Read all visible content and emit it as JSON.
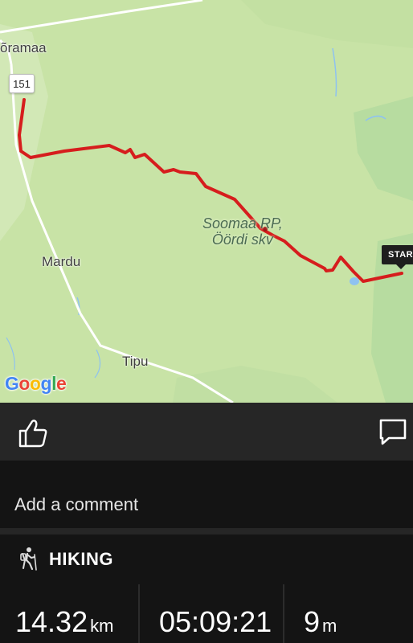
{
  "map": {
    "labels": {
      "oramaa": "õramaa",
      "mardu": "Mardu",
      "tipu": "Tipu",
      "poi_line1": "Soomaa RP,",
      "poi_line2": "Öördi skv"
    },
    "road_number": "151",
    "start_marker": "START",
    "attribution": [
      "G",
      "o",
      "o",
      "g",
      "l",
      "e"
    ],
    "colors": {
      "land": "#c8e3a6",
      "forest": "#b4d99b",
      "road": "#ffffff",
      "route": "#d61d1d",
      "water": "#8ec2f0"
    }
  },
  "actions": {
    "like_icon": "thumbs-up-icon",
    "comment_icon": "comment-icon"
  },
  "comment": {
    "placeholder": "Add a comment"
  },
  "activity": {
    "icon": "hiker-icon",
    "type": "HIKING"
  },
  "stats": {
    "distance": {
      "value": "14.32",
      "unit": "km"
    },
    "duration": {
      "value": "05:09:21"
    },
    "elevation": {
      "value": "9",
      "unit": "m"
    }
  }
}
